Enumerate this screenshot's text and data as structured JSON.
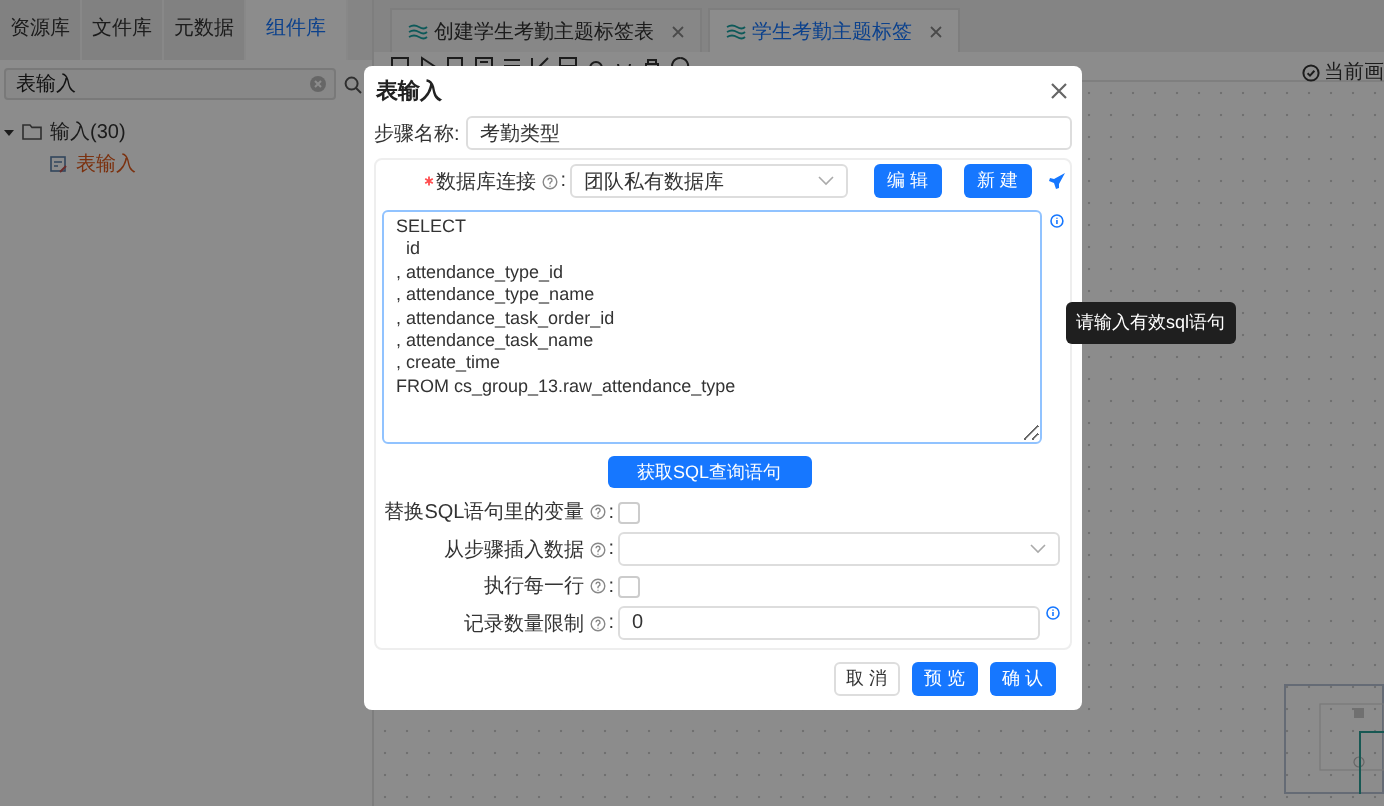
{
  "sidebar": {
    "tabs": [
      {
        "label": "资源库",
        "selected": false
      },
      {
        "label": "文件库",
        "selected": false
      },
      {
        "label": "元数据",
        "selected": false
      },
      {
        "label": "组件库",
        "selected": true
      }
    ],
    "search": {
      "value": "表输入"
    },
    "tree": [
      {
        "label": "输入(30)",
        "expanded": true,
        "children": [
          {
            "label": "表输入",
            "selected": true
          }
        ]
      }
    ]
  },
  "editor": {
    "tabs": [
      {
        "label": "创建学生考勤主题标签表",
        "selected": false
      },
      {
        "label": "学生考勤主题标签",
        "selected": true
      }
    ],
    "status": "当前画"
  },
  "dialog": {
    "title": "表输入",
    "colon": ":",
    "step_name": {
      "label": "步骤名称:",
      "value": "考勤类型"
    },
    "connection": {
      "label": "数据库连接",
      "required": true,
      "value": "团队私有数据库"
    },
    "buttons": [
      "编 辑",
      "新 建"
    ],
    "sql": "SELECT\n  id\n, attendance_type_id\n, attendance_type_name\n, attendance_task_order_id\n, attendance_task_name\n, create_time\nFROM cs_group_13.raw_attendance_type",
    "tooltip": "请输入有效sql语句",
    "fetch_button": "获取SQL查询语句",
    "fields": [
      {
        "kind": "checkbox",
        "label": "替换SQL语句里的变量",
        "checked": false
      },
      {
        "kind": "select",
        "label": "从步骤插入数据"
      },
      {
        "kind": "checkbox",
        "label": "执行每一行",
        "checked": false
      },
      {
        "kind": "input",
        "label": "记录数量限制",
        "value": "0"
      }
    ],
    "footer": [
      {
        "label": "取 消",
        "primary": false
      },
      {
        "label": "预 览",
        "primary": true
      },
      {
        "label": "确 认",
        "primary": true
      }
    ]
  }
}
